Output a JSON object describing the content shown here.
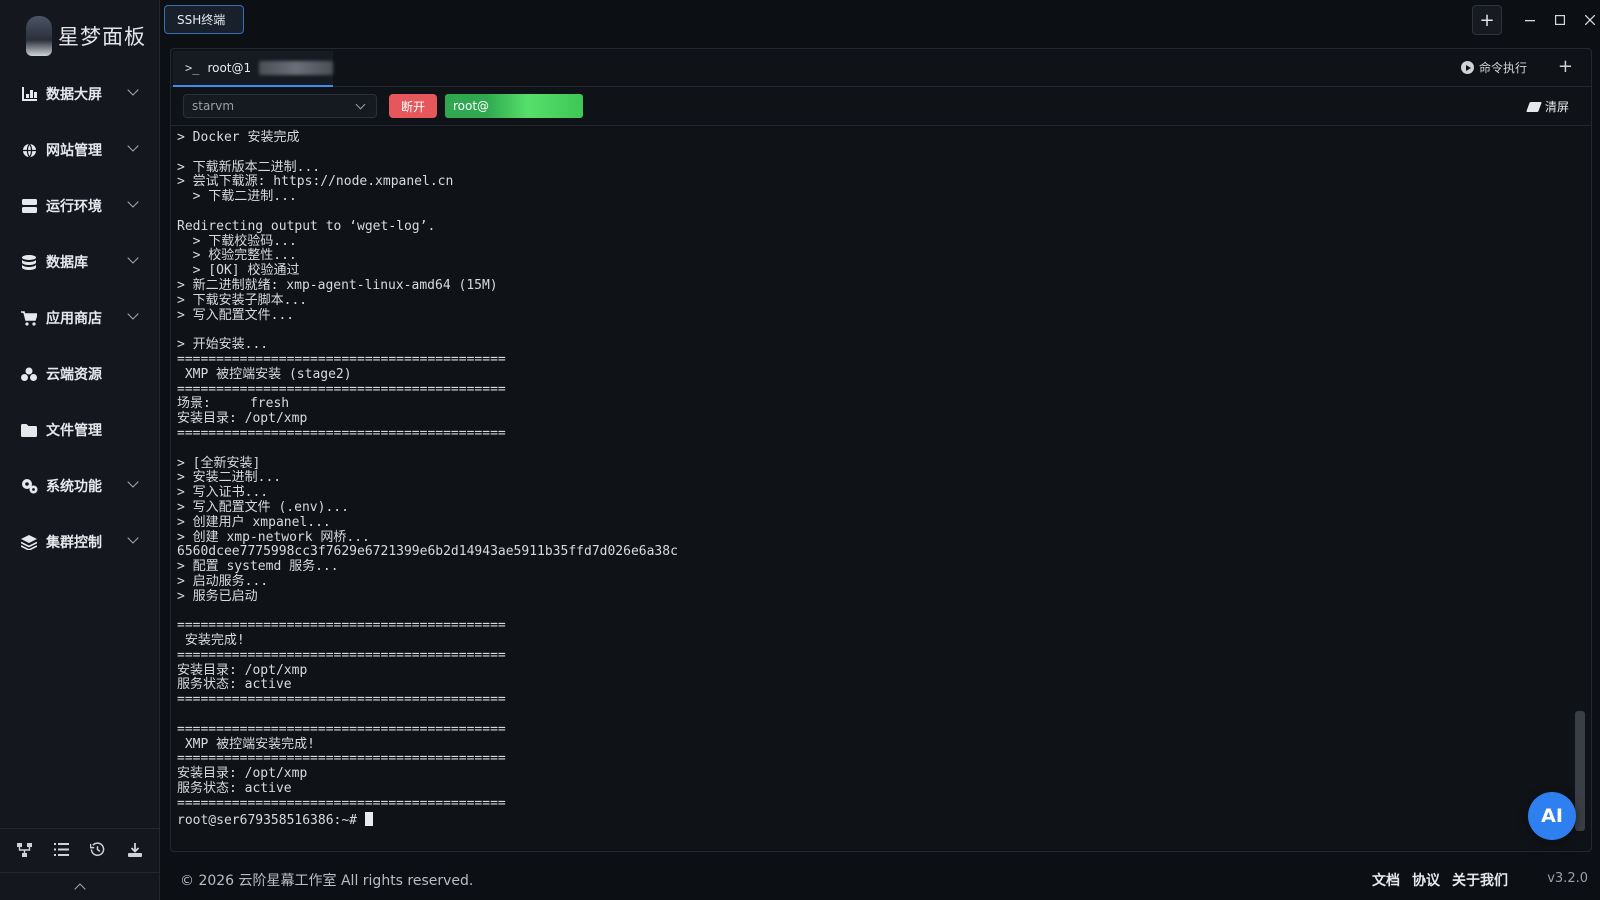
{
  "app": {
    "logo_text": "星梦面板",
    "version": "v3.2.0"
  },
  "sidebar": {
    "items": [
      {
        "label": "数据大屏",
        "icon": "bar-chart-icon"
      },
      {
        "label": "网站管理",
        "icon": "globe-icon"
      },
      {
        "label": "运行环境",
        "icon": "server-icon"
      },
      {
        "label": "数据库",
        "icon": "database-icon"
      },
      {
        "label": "应用商店",
        "icon": "cart-icon"
      },
      {
        "label": "云端资源",
        "icon": "cloud-icon"
      },
      {
        "label": "文件管理",
        "icon": "folder-icon"
      },
      {
        "label": "系统功能",
        "icon": "gears-icon"
      },
      {
        "label": "集群控制",
        "icon": "layers-icon"
      }
    ],
    "bottom_icons": [
      "network-icon",
      "list-icon",
      "history-icon",
      "download-icon"
    ]
  },
  "topbar": {
    "tab_label": "SSH终端"
  },
  "panel": {
    "tab_label": "root@1",
    "cmd_exec_label": "命令执行",
    "server_select": "starvm",
    "disconnect_label": "断开",
    "status_label": "root@",
    "clear_label": "清屏"
  },
  "terminal": {
    "lines": [
      "> Docker 安装完成",
      "",
      "> 下载新版本二进制...",
      "> 尝试下载源: https://node.xmpanel.cn",
      "  > 下载二进制...",
      "",
      "Redirecting output to ‘wget-log’.",
      "  > 下载校验码...",
      "  > 校验完整性...",
      "  > [OK] 校验通过",
      "> 新二进制就绪: xmp-agent-linux-amd64 (15M)",
      "> 下载安装子脚本...",
      "> 写入配置文件...",
      "",
      "> 开始安装...",
      "==========================================",
      " XMP 被控端安装 (stage2)",
      "==========================================",
      "场景:     fresh",
      "安装目录: /opt/xmp",
      "==========================================",
      "",
      "> [全新安装]",
      "> 安装二进制...",
      "> 写入证书...",
      "> 写入配置文件 (.env)...",
      "> 创建用户 xmpanel...",
      "> 创建 xmp-network 网桥...",
      "6560dcee7775998cc3f7629e6721399e6b2d14943ae5911b35ffd7d026e6a38c",
      "> 配置 systemd 服务...",
      "> 启动服务...",
      "> 服务已启动",
      "",
      "==========================================",
      " 安装完成!",
      "==========================================",
      "安装目录: /opt/xmp",
      "服务状态: active",
      "==========================================",
      "",
      "==========================================",
      " XMP 被控端安装完成!",
      "==========================================",
      "安装目录: /opt/xmp",
      "服务状态: active",
      "=========================================="
    ],
    "prompt": "root@ser679358516386:~# "
  },
  "ai_button": "AI",
  "footer": {
    "copyright": "© 2026 云阶星幕工作室 All rights reserved.",
    "links": [
      "文档",
      "协议",
      "关于我们"
    ]
  }
}
